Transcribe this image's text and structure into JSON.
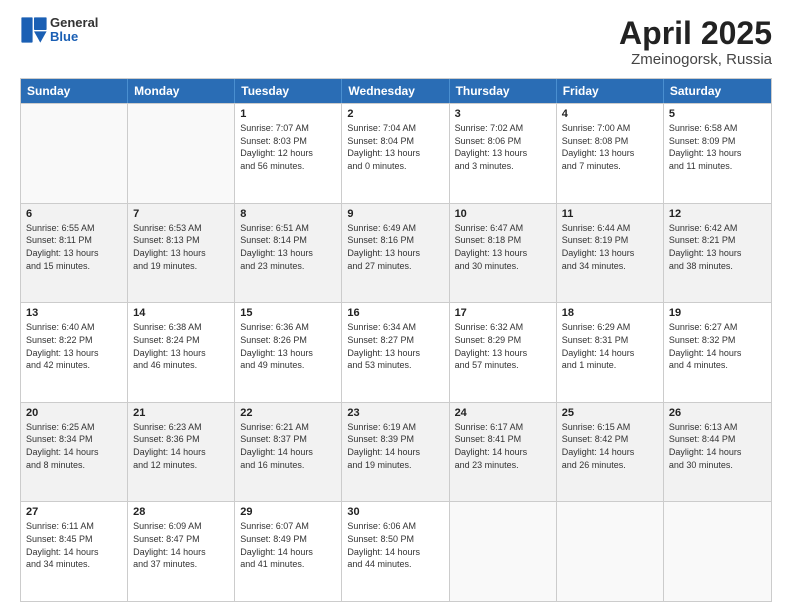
{
  "header": {
    "logo_general": "General",
    "logo_blue": "Blue",
    "title": "April 2025",
    "subtitle": "Zmeinogorsk, Russia"
  },
  "calendar": {
    "days_of_week": [
      "Sunday",
      "Monday",
      "Tuesday",
      "Wednesday",
      "Thursday",
      "Friday",
      "Saturday"
    ],
    "weeks": [
      [
        {
          "day": "",
          "empty": true,
          "lines": []
        },
        {
          "day": "",
          "empty": true,
          "lines": []
        },
        {
          "day": "1",
          "lines": [
            "Sunrise: 7:07 AM",
            "Sunset: 8:03 PM",
            "Daylight: 12 hours",
            "and 56 minutes."
          ]
        },
        {
          "day": "2",
          "lines": [
            "Sunrise: 7:04 AM",
            "Sunset: 8:04 PM",
            "Daylight: 13 hours",
            "and 0 minutes."
          ]
        },
        {
          "day": "3",
          "lines": [
            "Sunrise: 7:02 AM",
            "Sunset: 8:06 PM",
            "Daylight: 13 hours",
            "and 3 minutes."
          ]
        },
        {
          "day": "4",
          "lines": [
            "Sunrise: 7:00 AM",
            "Sunset: 8:08 PM",
            "Daylight: 13 hours",
            "and 7 minutes."
          ]
        },
        {
          "day": "5",
          "lines": [
            "Sunrise: 6:58 AM",
            "Sunset: 8:09 PM",
            "Daylight: 13 hours",
            "and 11 minutes."
          ]
        }
      ],
      [
        {
          "day": "6",
          "lines": [
            "Sunrise: 6:55 AM",
            "Sunset: 8:11 PM",
            "Daylight: 13 hours",
            "and 15 minutes."
          ]
        },
        {
          "day": "7",
          "lines": [
            "Sunrise: 6:53 AM",
            "Sunset: 8:13 PM",
            "Daylight: 13 hours",
            "and 19 minutes."
          ]
        },
        {
          "day": "8",
          "lines": [
            "Sunrise: 6:51 AM",
            "Sunset: 8:14 PM",
            "Daylight: 13 hours",
            "and 23 minutes."
          ]
        },
        {
          "day": "9",
          "lines": [
            "Sunrise: 6:49 AM",
            "Sunset: 8:16 PM",
            "Daylight: 13 hours",
            "and 27 minutes."
          ]
        },
        {
          "day": "10",
          "lines": [
            "Sunrise: 6:47 AM",
            "Sunset: 8:18 PM",
            "Daylight: 13 hours",
            "and 30 minutes."
          ]
        },
        {
          "day": "11",
          "lines": [
            "Sunrise: 6:44 AM",
            "Sunset: 8:19 PM",
            "Daylight: 13 hours",
            "and 34 minutes."
          ]
        },
        {
          "day": "12",
          "lines": [
            "Sunrise: 6:42 AM",
            "Sunset: 8:21 PM",
            "Daylight: 13 hours",
            "and 38 minutes."
          ]
        }
      ],
      [
        {
          "day": "13",
          "lines": [
            "Sunrise: 6:40 AM",
            "Sunset: 8:22 PM",
            "Daylight: 13 hours",
            "and 42 minutes."
          ]
        },
        {
          "day": "14",
          "lines": [
            "Sunrise: 6:38 AM",
            "Sunset: 8:24 PM",
            "Daylight: 13 hours",
            "and 46 minutes."
          ]
        },
        {
          "day": "15",
          "lines": [
            "Sunrise: 6:36 AM",
            "Sunset: 8:26 PM",
            "Daylight: 13 hours",
            "and 49 minutes."
          ]
        },
        {
          "day": "16",
          "lines": [
            "Sunrise: 6:34 AM",
            "Sunset: 8:27 PM",
            "Daylight: 13 hours",
            "and 53 minutes."
          ]
        },
        {
          "day": "17",
          "lines": [
            "Sunrise: 6:32 AM",
            "Sunset: 8:29 PM",
            "Daylight: 13 hours",
            "and 57 minutes."
          ]
        },
        {
          "day": "18",
          "lines": [
            "Sunrise: 6:29 AM",
            "Sunset: 8:31 PM",
            "Daylight: 14 hours",
            "and 1 minute."
          ]
        },
        {
          "day": "19",
          "lines": [
            "Sunrise: 6:27 AM",
            "Sunset: 8:32 PM",
            "Daylight: 14 hours",
            "and 4 minutes."
          ]
        }
      ],
      [
        {
          "day": "20",
          "lines": [
            "Sunrise: 6:25 AM",
            "Sunset: 8:34 PM",
            "Daylight: 14 hours",
            "and 8 minutes."
          ]
        },
        {
          "day": "21",
          "lines": [
            "Sunrise: 6:23 AM",
            "Sunset: 8:36 PM",
            "Daylight: 14 hours",
            "and 12 minutes."
          ]
        },
        {
          "day": "22",
          "lines": [
            "Sunrise: 6:21 AM",
            "Sunset: 8:37 PM",
            "Daylight: 14 hours",
            "and 16 minutes."
          ]
        },
        {
          "day": "23",
          "lines": [
            "Sunrise: 6:19 AM",
            "Sunset: 8:39 PM",
            "Daylight: 14 hours",
            "and 19 minutes."
          ]
        },
        {
          "day": "24",
          "lines": [
            "Sunrise: 6:17 AM",
            "Sunset: 8:41 PM",
            "Daylight: 14 hours",
            "and 23 minutes."
          ]
        },
        {
          "day": "25",
          "lines": [
            "Sunrise: 6:15 AM",
            "Sunset: 8:42 PM",
            "Daylight: 14 hours",
            "and 26 minutes."
          ]
        },
        {
          "day": "26",
          "lines": [
            "Sunrise: 6:13 AM",
            "Sunset: 8:44 PM",
            "Daylight: 14 hours",
            "and 30 minutes."
          ]
        }
      ],
      [
        {
          "day": "27",
          "lines": [
            "Sunrise: 6:11 AM",
            "Sunset: 8:45 PM",
            "Daylight: 14 hours",
            "and 34 minutes."
          ]
        },
        {
          "day": "28",
          "lines": [
            "Sunrise: 6:09 AM",
            "Sunset: 8:47 PM",
            "Daylight: 14 hours",
            "and 37 minutes."
          ]
        },
        {
          "day": "29",
          "lines": [
            "Sunrise: 6:07 AM",
            "Sunset: 8:49 PM",
            "Daylight: 14 hours",
            "and 41 minutes."
          ]
        },
        {
          "day": "30",
          "lines": [
            "Sunrise: 6:06 AM",
            "Sunset: 8:50 PM",
            "Daylight: 14 hours",
            "and 44 minutes."
          ]
        },
        {
          "day": "",
          "empty": true,
          "lines": []
        },
        {
          "day": "",
          "empty": true,
          "lines": []
        },
        {
          "day": "",
          "empty": true,
          "lines": []
        }
      ]
    ]
  }
}
